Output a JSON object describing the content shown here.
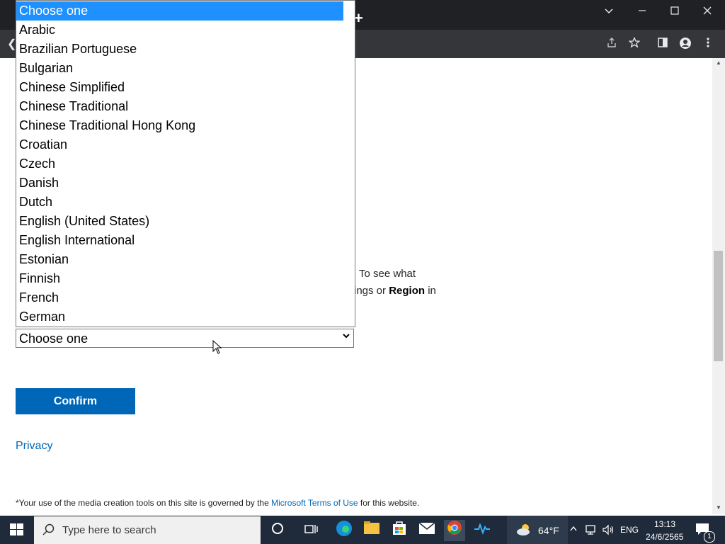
{
  "window": {
    "new_tab_icon": "plus-icon",
    "controls": [
      "tab-search-icon",
      "minimize-icon",
      "maximize-icon",
      "close-icon"
    ]
  },
  "toolbar": {
    "icons": [
      "back-arrow-icon",
      "share-icon",
      "star-icon",
      "side-panel-icon",
      "profile-icon",
      "menu-icon"
    ]
  },
  "page": {
    "instructions_part1": "To see what",
    "instructions_part2_pre": "ings or ",
    "instructions_part2_bold": "Region",
    "instructions_part2_post": " in",
    "language_select": {
      "value": "Choose one",
      "options": [
        "Choose one",
        "Arabic",
        "Brazilian Portuguese",
        "Bulgarian",
        "Chinese Simplified",
        "Chinese Traditional",
        "Chinese Traditional Hong Kong",
        "Croatian",
        "Czech",
        "Danish",
        "Dutch",
        "English (United States)",
        "English International",
        "Estonian",
        "Finnish",
        "French",
        "German"
      ],
      "highlighted": "Choose one"
    },
    "confirm_label": "Confirm",
    "privacy_label": "Privacy",
    "footer_pre": "*Your use of the media creation tools on this site is governed by the ",
    "footer_link": "Microsoft Terms of Use",
    "footer_post": " for this website."
  },
  "taskbar": {
    "search_placeholder": "Type here to search",
    "weather_temp": "64°F",
    "language": "ENG",
    "time": "13:13",
    "date": "24/6/2565",
    "notification_count": "1",
    "apps": [
      "cortana-icon",
      "task-view-icon",
      "edge-icon",
      "file-explorer-icon",
      "store-icon",
      "mail-icon",
      "chrome-icon",
      "health-app-icon"
    ]
  },
  "colors": {
    "accent": "#0067b8",
    "highlight": "#1e90ff",
    "chrome_dark": "#202124",
    "taskbar": "#1f2b3a"
  }
}
